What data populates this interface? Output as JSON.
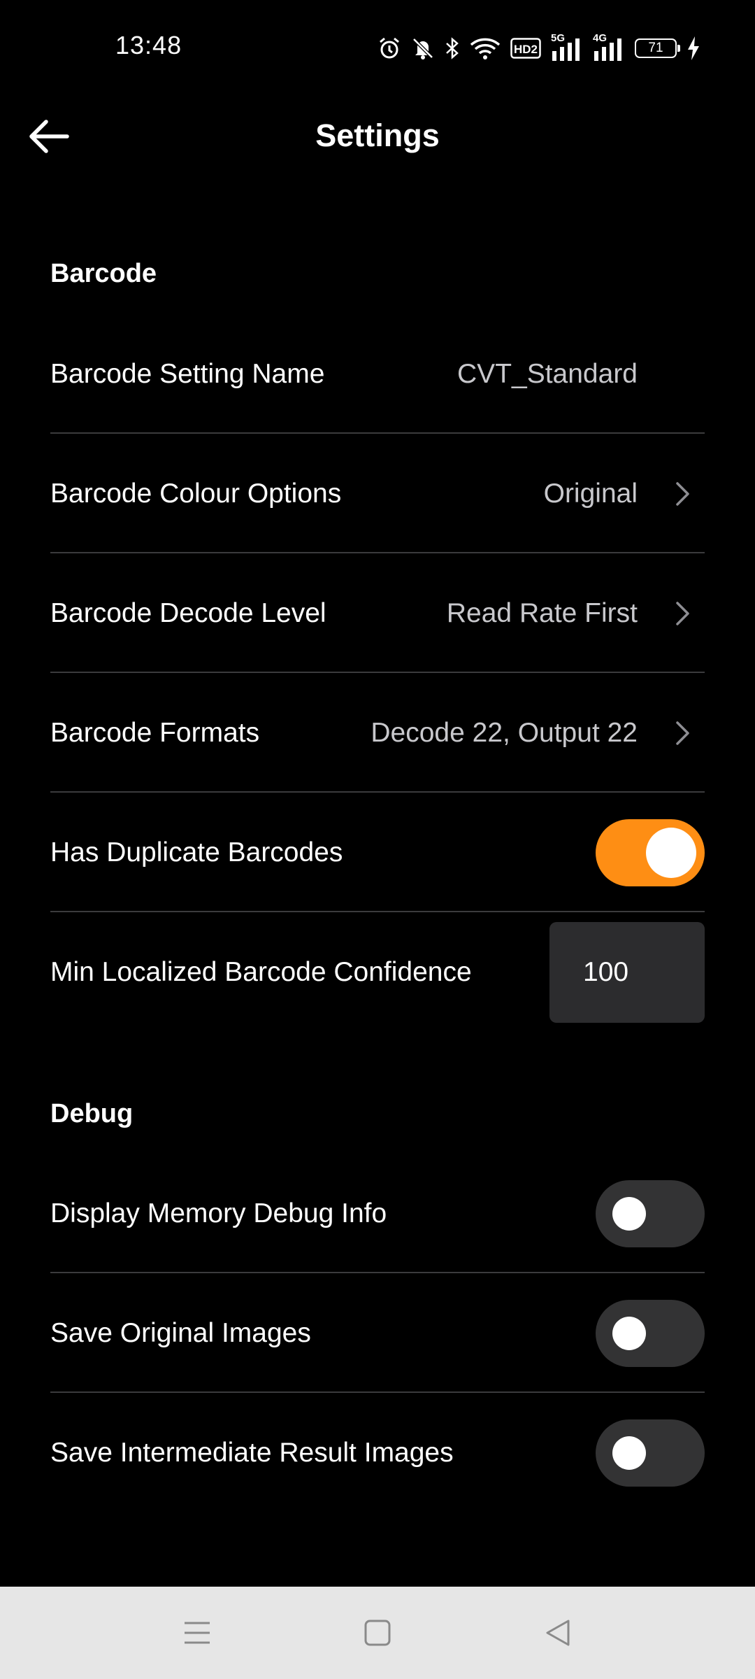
{
  "status_bar": {
    "time": "13:48",
    "network_1": "5G",
    "network_2": "4G",
    "hd_label": "HD2",
    "battery": "71",
    "icons": [
      "alarm-icon",
      "bell-muted-icon",
      "bluetooth-icon",
      "wifi-icon",
      "hd-voice-icon",
      "signal-5g-icon",
      "signal-4g-icon",
      "battery-icon",
      "charging-icon"
    ]
  },
  "app_bar": {
    "title": "Settings",
    "back_icon": "arrow-left-icon"
  },
  "sections": {
    "barcode": {
      "header": "Barcode",
      "setting_name": {
        "label": "Barcode Setting Name",
        "value": "CVT_Standard"
      },
      "colour_options": {
        "label": "Barcode Colour Options",
        "value": "Original"
      },
      "decode_level": {
        "label": "Barcode Decode Level",
        "value": "Read Rate First"
      },
      "formats": {
        "label": "Barcode Formats",
        "value": "Decode 22, Output 22"
      },
      "duplicates": {
        "label": "Has Duplicate Barcodes",
        "enabled": true
      },
      "min_confidence": {
        "label": "Min Localized Barcode Confidence",
        "value": "100"
      }
    },
    "debug": {
      "header": "Debug",
      "memory_info": {
        "label": "Display Memory Debug Info",
        "enabled": false
      },
      "save_original": {
        "label": "Save Original Images",
        "enabled": false
      },
      "save_intermediate": {
        "label": "Save Intermediate Result Images",
        "enabled": false
      }
    }
  },
  "colors": {
    "accent": "#fe8e14",
    "background": "#000000",
    "toggle_off": "#333334",
    "divider": "#3b3b3d",
    "nav_bar": "#e6e6e6"
  },
  "nav_bar": {
    "icons": [
      "menu-icon",
      "home-square-icon",
      "back-triangle-icon"
    ]
  }
}
